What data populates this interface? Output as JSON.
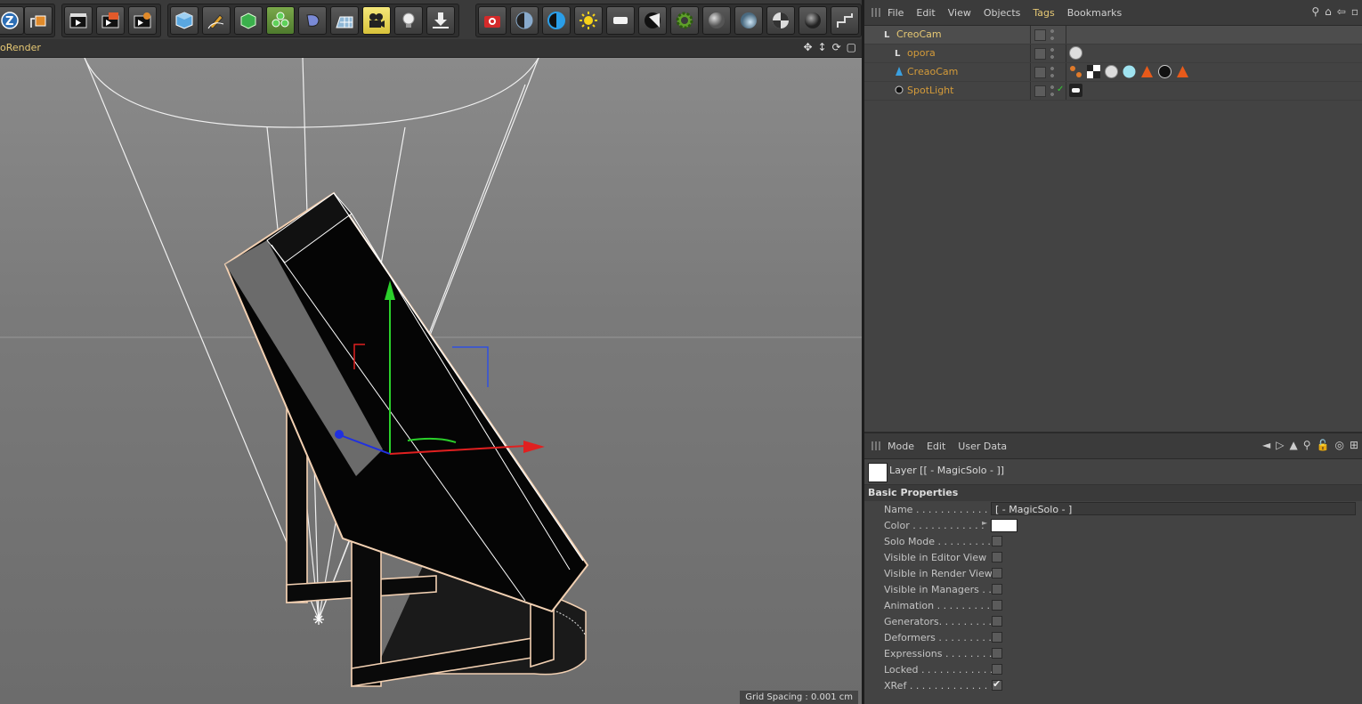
{
  "toolbar": {
    "buttons": [
      "undo-z-icon",
      "cube-export-icon",
      "render-view-icon",
      "render-picture-icon",
      "render-settings-icon",
      "cube-primitive-icon",
      "pen-spline-icon",
      "subdivision-icon",
      "mograph-cloner-icon",
      "deformer-icon",
      "floor-icon",
      "camera-icon",
      "light-bulb-icon",
      "download-scene-icon",
      "red-camera-icon",
      "contrast-icon",
      "half-circle-icon",
      "sun-icon",
      "area-light-icon",
      "spot-light-icon",
      "gear-tag-icon",
      "sphere-gray-icon",
      "sphere-glass-icon",
      "checker-sphere-icon",
      "sphere-dark-icon",
      "connect-icon"
    ]
  },
  "viewport": {
    "title": "oRender",
    "grid_spacing": "Grid Spacing : 0.001 cm"
  },
  "object_manager": {
    "menu": [
      "File",
      "Edit",
      "View",
      "Objects",
      "Tags",
      "Bookmarks"
    ],
    "active_menu": "Tags",
    "objects": [
      {
        "name": "CreoCam",
        "indent": 0,
        "color": "#e6c874",
        "check": false
      },
      {
        "name": "opora",
        "indent": 1,
        "color": "#d49b3a",
        "check": false
      },
      {
        "name": "CreaoCam",
        "indent": 1,
        "color": "#d49b3a",
        "check": false
      },
      {
        "name": "SpotLight",
        "indent": 1,
        "color": "#d49b3a",
        "check": true
      }
    ]
  },
  "attribute_manager": {
    "menu": [
      "Mode",
      "Edit",
      "User Data"
    ],
    "layer_title": "Layer [[ - MagicSolo - ]]",
    "section": "Basic Properties",
    "name_label": "Name . . . . . . . . . . . . . . .",
    "name_value": "[ - MagicSolo - ]",
    "color_label": "Color . . . . . . . . . . . .",
    "properties": [
      {
        "label": "Solo Mode . . . . . . . . . .",
        "checked": false
      },
      {
        "label": "Visible in Editor View",
        "checked": false
      },
      {
        "label": "Visible in Render View",
        "checked": false
      },
      {
        "label": "Visible in Managers . .",
        "checked": false
      },
      {
        "label": "Animation . . . . . . . . . .",
        "checked": false
      },
      {
        "label": "Generators. . . . . . . . . .",
        "checked": false
      },
      {
        "label": "Deformers . . . . . . . . . .",
        "checked": false
      },
      {
        "label": "Expressions . . . . . . . . .",
        "checked": false
      },
      {
        "label": "Locked . . . . . . . . . . . .",
        "checked": false
      },
      {
        "label": "XRef . . . . . . . . . . . . . . .",
        "checked": true
      }
    ]
  }
}
